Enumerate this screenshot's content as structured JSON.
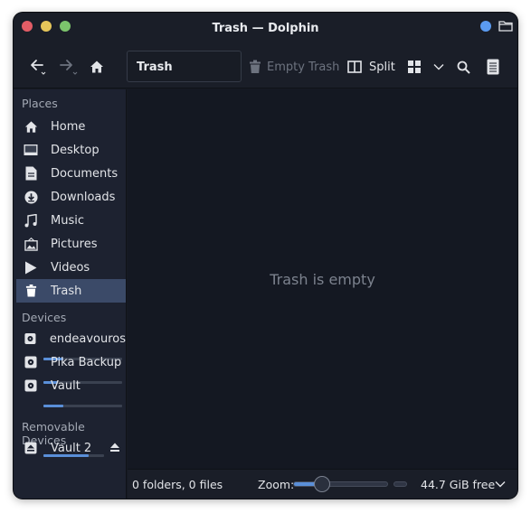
{
  "window": {
    "title": "Trash — Dolphin",
    "accent": "#5b9bf1"
  },
  "toolbar": {
    "location": "Trash",
    "empty_trash_label": "Empty Trash",
    "split_label": "Split",
    "icons": [
      "back-arrow-icon",
      "forward-arrow-icon",
      "home-icon",
      "trash-icon",
      "split-view-icon",
      "grid-view-icon",
      "chevron-down-icon",
      "search-icon",
      "hamburger-menu-icon"
    ]
  },
  "sidebar": {
    "places_header": "Places",
    "places": [
      {
        "label": "Home",
        "icon": "home-icon"
      },
      {
        "label": "Desktop",
        "icon": "desktop-icon"
      },
      {
        "label": "Documents",
        "icon": "document-icon"
      },
      {
        "label": "Downloads",
        "icon": "download-icon"
      },
      {
        "label": "Music",
        "icon": "music-icon"
      },
      {
        "label": "Pictures",
        "icon": "picture-icon"
      },
      {
        "label": "Videos",
        "icon": "video-icon"
      },
      {
        "label": "Trash",
        "icon": "trash-icon",
        "active": true
      }
    ],
    "devices_header": "Devices",
    "devices": [
      {
        "label": "endeavouros",
        "icon": "disk-icon",
        "usage": 0.25
      },
      {
        "label": "Pika Backup",
        "icon": "disk-icon",
        "usage": 0.18
      },
      {
        "label": "Vault",
        "icon": "disk-icon",
        "usage": 0.25
      }
    ],
    "removable_header": "Removable Devices",
    "removable": [
      {
        "label": "Vault 2",
        "icon": "eject-drive-icon",
        "usage": 0.75
      }
    ]
  },
  "main": {
    "empty_message": "Trash is empty"
  },
  "statusbar": {
    "summary": "0 folders, 0 files",
    "zoom_label": "Zoom:",
    "zoom_level": 0.3,
    "free_space": "44.7 GiB free"
  }
}
